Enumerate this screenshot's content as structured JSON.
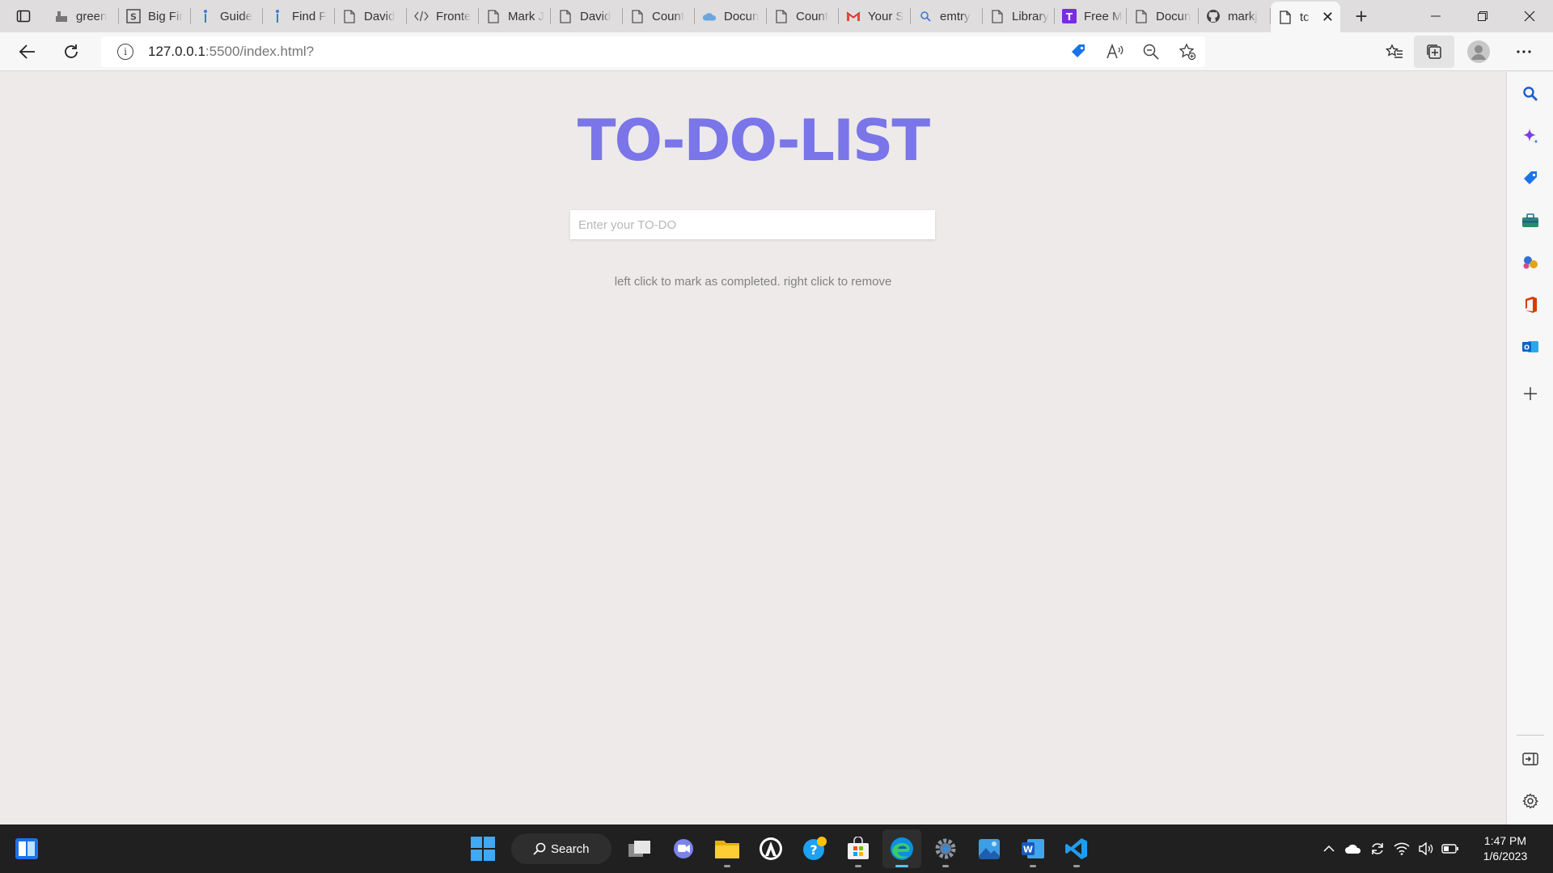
{
  "browser": {
    "tabs": [
      {
        "title": "green",
        "icon": "site-icon"
      },
      {
        "title": "Big Fir",
        "icon": "is-logo-icon"
      },
      {
        "title": "Guide",
        "icon": "person-icon"
      },
      {
        "title": "Find F",
        "icon": "person-icon"
      },
      {
        "title": "David",
        "icon": "page-icon"
      },
      {
        "title": "Fronte",
        "icon": "code-icon"
      },
      {
        "title": "Mark J",
        "icon": "page-icon"
      },
      {
        "title": "David",
        "icon": "page-icon"
      },
      {
        "title": "Count",
        "icon": "page-icon"
      },
      {
        "title": "Docun",
        "icon": "cloud-icon"
      },
      {
        "title": "Count",
        "icon": "page-icon"
      },
      {
        "title": "Your S",
        "icon": "gmail-icon"
      },
      {
        "title": "emtry",
        "icon": "search-icon"
      },
      {
        "title": "Library",
        "icon": "page-icon"
      },
      {
        "title": "Free M",
        "icon": "t-logo-icon"
      },
      {
        "title": "Docun",
        "icon": "page-icon"
      },
      {
        "title": "markj",
        "icon": "github-icon"
      }
    ],
    "active_tab": {
      "title": "tc"
    },
    "address": {
      "host": "127.0.0.1",
      "rest": ":5500/index.html?"
    }
  },
  "app": {
    "title": "TO-DO-LIST",
    "input_placeholder": "Enter your TO-DO",
    "hint": "left click to mark as completed. right click to remove",
    "accent": "#7a75e8",
    "background": "#edeae9"
  },
  "taskbar": {
    "search_label": "Search",
    "time": "1:47 PM",
    "date": "1/6/2023"
  }
}
